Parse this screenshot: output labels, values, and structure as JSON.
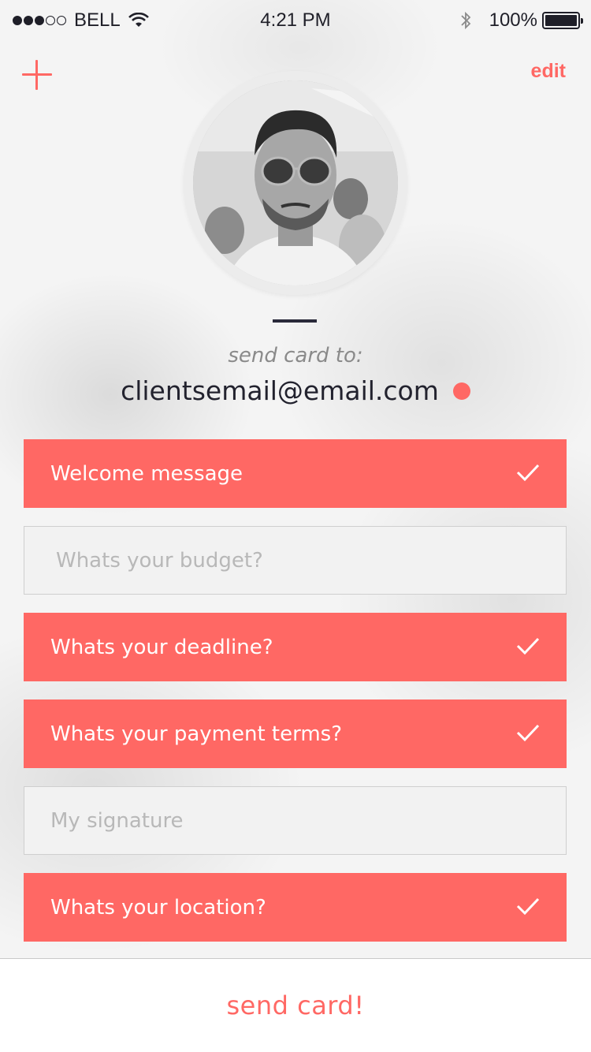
{
  "status_bar": {
    "carrier": "BELL",
    "time": "4:21 PM",
    "battery_percent": "100%",
    "signal_strength": 3,
    "icons": [
      "signal-dots-icon",
      "wifi-icon",
      "bluetooth-icon",
      "battery-icon"
    ]
  },
  "header": {
    "add_icon": "plus-icon",
    "edit_label": "edit"
  },
  "recipient": {
    "label": "send card to:",
    "email": "clientsemail@email.com",
    "status_color": "#ff6864"
  },
  "items": [
    {
      "label": "Welcome message",
      "checked": true
    },
    {
      "label": "Whats your budget?",
      "checked": false
    },
    {
      "label": "Whats your deadline?",
      "checked": true
    },
    {
      "label": "Whats your payment terms?",
      "checked": true
    },
    {
      "label": "My signature",
      "checked": false
    },
    {
      "label": "Whats your location?",
      "checked": true
    }
  ],
  "footer": {
    "send_label": "send card!"
  },
  "colors": {
    "accent": "#ff6864",
    "text_dark": "#22222e",
    "text_muted": "#8a8a8a",
    "placeholder": "#b8b8b8"
  }
}
